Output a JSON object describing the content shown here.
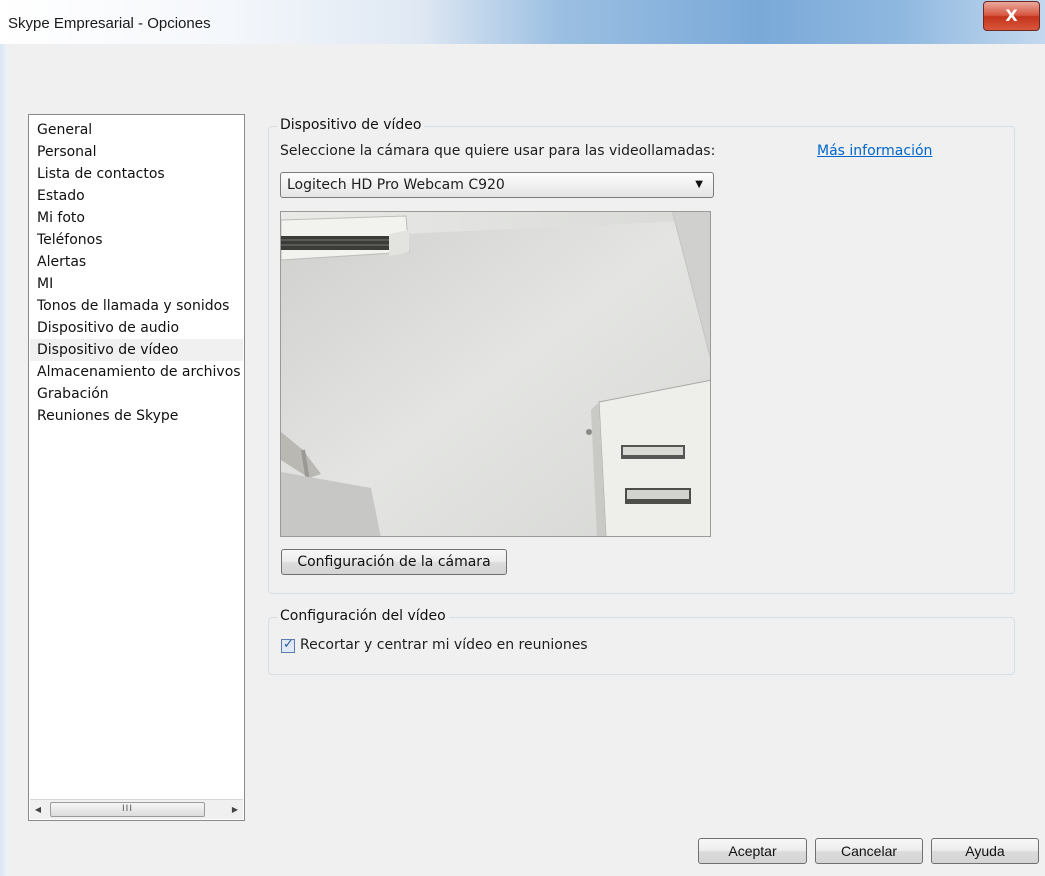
{
  "window": {
    "title": "Skype Empresarial - Opciones",
    "close_glyph": "X"
  },
  "sidebar": {
    "items": [
      {
        "label": "General"
      },
      {
        "label": "Personal"
      },
      {
        "label": "Lista de contactos"
      },
      {
        "label": "Estado"
      },
      {
        "label": "Mi foto"
      },
      {
        "label": "Teléfonos"
      },
      {
        "label": "Alertas"
      },
      {
        "label": "MI"
      },
      {
        "label": "Tonos de llamada y sonidos"
      },
      {
        "label": "Dispositivo de audio"
      },
      {
        "label": "Dispositivo de vídeo",
        "selected": true
      },
      {
        "label": "Almacenamiento de archivos"
      },
      {
        "label": "Grabación"
      },
      {
        "label": "Reuniones de Skype"
      }
    ],
    "scrollbar_grip": "III"
  },
  "video_device": {
    "section_title": "Dispositivo de vídeo",
    "select_label": "Seleccione la cámara que quiere usar para las videollamadas:",
    "more_info_link": "Más información",
    "camera_selected": "Logitech HD Pro Webcam C920",
    "camera_settings_button": "Configuración de la cámara"
  },
  "video_settings": {
    "section_title": "Configuración del vídeo",
    "crop_center_label": "Recortar y centrar mi vídeo en reuniones",
    "crop_center_checked": true
  },
  "footer": {
    "ok": "Aceptar",
    "cancel": "Cancelar",
    "help": "Ayuda"
  },
  "colors": {
    "title_gradient_accent": "#7aa9d8",
    "link": "#0066cc",
    "close_button": "#c3331b"
  }
}
